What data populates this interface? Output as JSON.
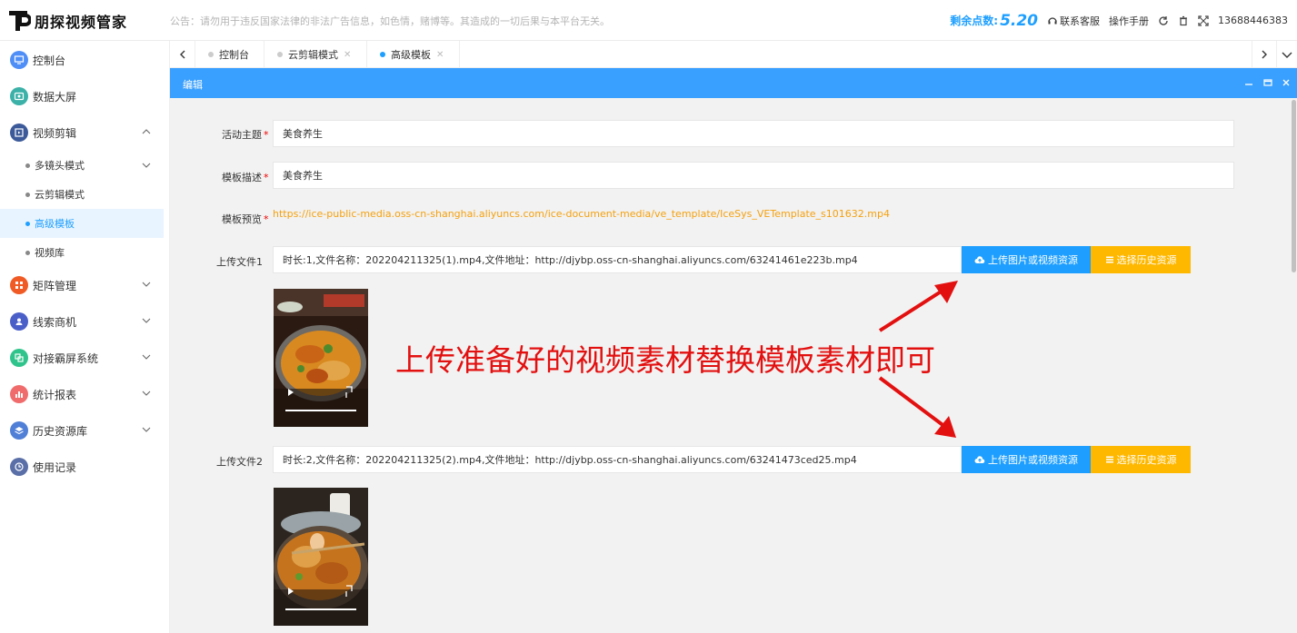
{
  "app": {
    "logo_text": "朋探视频管家",
    "notice": "公告：请勿用于违反国家法律的非法广告信息，如色情，赌博等。其造成的一切后果与本平台无关。",
    "points_label": "剩余点数:",
    "points_value": "5.20",
    "support_label": "联系客服",
    "manual_label": "操作手册",
    "phone": "13688446383",
    "accent": "#1e9fff"
  },
  "sidebar": {
    "items": [
      {
        "label": "控制台",
        "icon": "monitor-icon",
        "color": "#4f8ef7"
      },
      {
        "label": "数据大屏",
        "icon": "screen-icon",
        "color": "#3bb1a8"
      },
      {
        "label": "视频剪辑",
        "icon": "video-edit-icon",
        "color": "#3c5a99"
      },
      {
        "label": "矩阵管理",
        "icon": "matrix-icon",
        "color": "#f05a24"
      },
      {
        "label": "线索商机",
        "icon": "leads-icon",
        "color": "#4b5fc9"
      },
      {
        "label": "对接霸屏系统",
        "icon": "link-icon",
        "color": "#2fc48b"
      },
      {
        "label": "统计报表",
        "icon": "chart-icon",
        "color": "#f06c6c"
      },
      {
        "label": "历史资源库",
        "icon": "layers-icon",
        "color": "#4f7fd6"
      },
      {
        "label": "使用记录",
        "icon": "clock-icon",
        "color": "#5a6fa8"
      }
    ],
    "sub_items": [
      {
        "label": "多镜头模式"
      },
      {
        "label": "云剪辑模式"
      },
      {
        "label": "高级模板"
      },
      {
        "label": "视频库"
      }
    ]
  },
  "tabs": [
    {
      "label": "控制台"
    },
    {
      "label": "云剪辑模式"
    },
    {
      "label": "高级模板"
    }
  ],
  "panel": {
    "title": "编辑"
  },
  "form": {
    "theme_label": "活动主题",
    "theme_value": "美食养生",
    "desc_label": "模板描述",
    "desc_value": "美食养生",
    "preview_label": "模板预览",
    "preview_url": "https://ice-public-media.oss-cn-shanghai.aliyuncs.com/ice-document-media/ve_template/IceSys_VETemplate_s101632.mp4",
    "required_mark": "*",
    "uploads": [
      {
        "label": "上传文件1",
        "value": "时长:1,文件名称：202204211325(1).mp4,文件地址：http://djybp.oss-cn-shanghai.aliyuncs.com/63241461e223b.mp4"
      },
      {
        "label": "上传文件2",
        "value": "时长:2,文件名称：202204211325(2).mp4,文件地址：http://djybp.oss-cn-shanghai.aliyuncs.com/63241473ced25.mp4"
      }
    ],
    "upload_button": "上传图片或视频资源",
    "history_button": "选择历史资源"
  },
  "annotation": {
    "text": "上传准备好的视频素材替换模板素材即可",
    "color": "#e31010"
  }
}
